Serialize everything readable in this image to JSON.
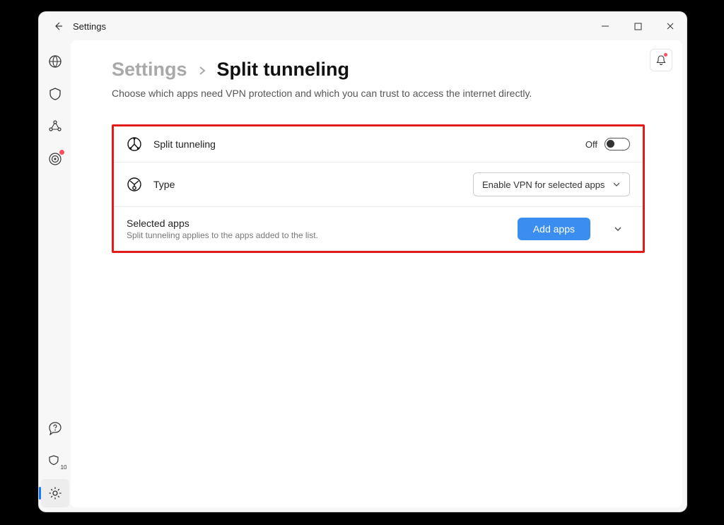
{
  "titlebar": {
    "title": "Settings"
  },
  "breadcrumb": {
    "root": "Settings",
    "current": "Split tunneling"
  },
  "subheader": "Choose which apps need VPN protection and which you can trust to access the internet directly.",
  "rows": {
    "split_tunneling": {
      "label": "Split tunneling",
      "state_text": "Off"
    },
    "type": {
      "label": "Type",
      "dropdown_value": "Enable VPN for selected apps"
    },
    "selected_apps": {
      "label": "Selected apps",
      "sublabel": "Split tunneling applies to the apps added to the list.",
      "button": "Add apps"
    }
  },
  "sidebar": {
    "upgrade_badge": "10"
  }
}
